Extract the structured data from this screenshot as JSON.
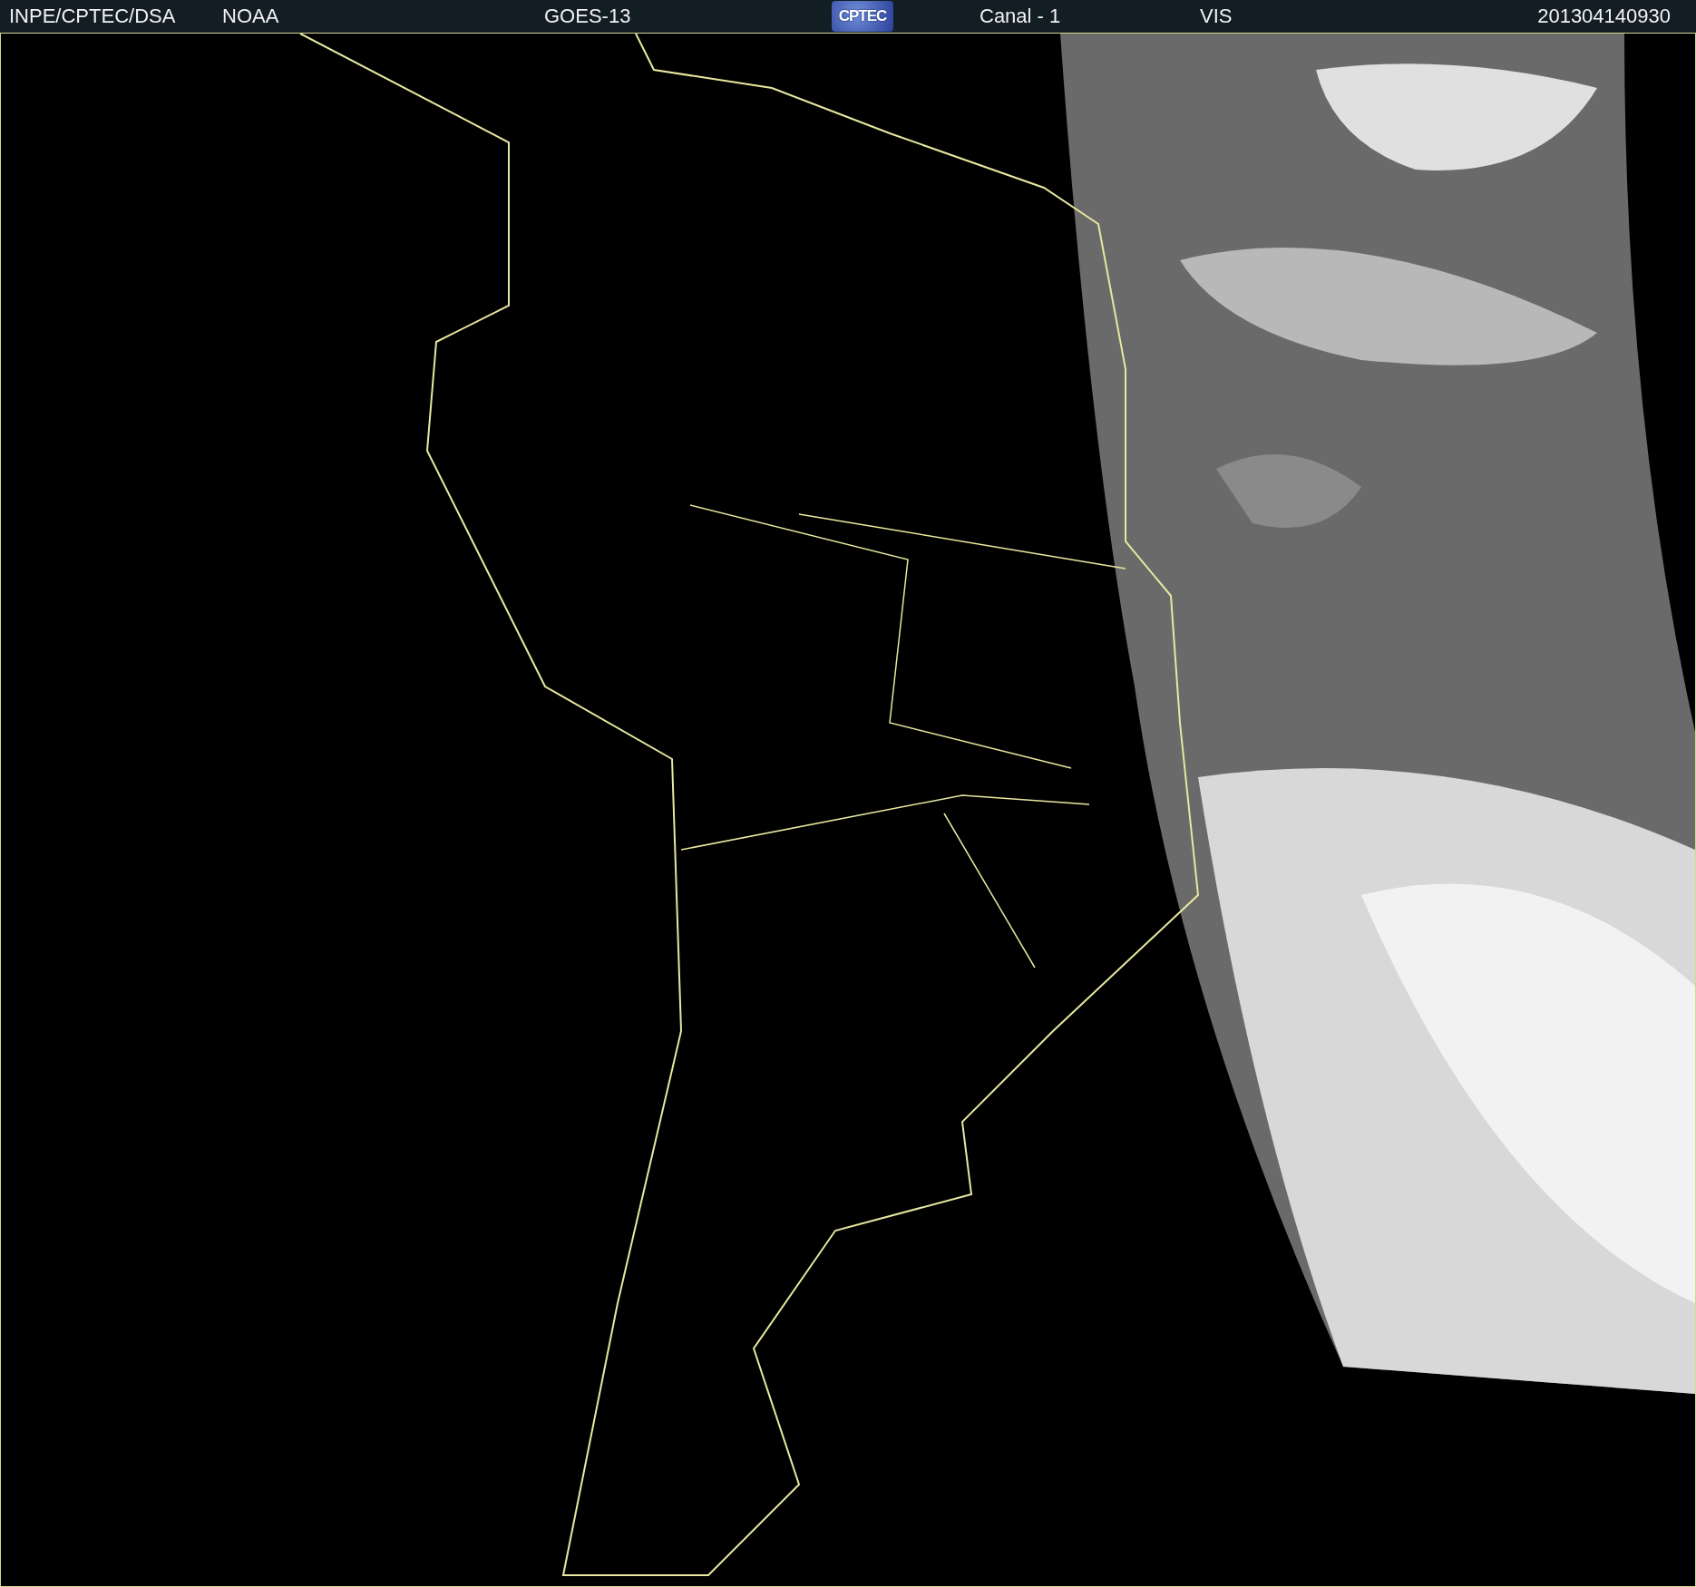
{
  "header": {
    "items": [
      {
        "kind": "text",
        "text": "INPE/CPTEC/DSA"
      },
      {
        "kind": "text",
        "text": "NOAA"
      },
      {
        "kind": "text",
        "text": "GOES-13"
      },
      {
        "kind": "logo",
        "text": "CPTEC"
      },
      {
        "kind": "text",
        "text": "Canal - 1"
      },
      {
        "kind": "text",
        "text": "VIS"
      },
      {
        "kind": "date",
        "text": "201304140930"
      }
    ]
  }
}
